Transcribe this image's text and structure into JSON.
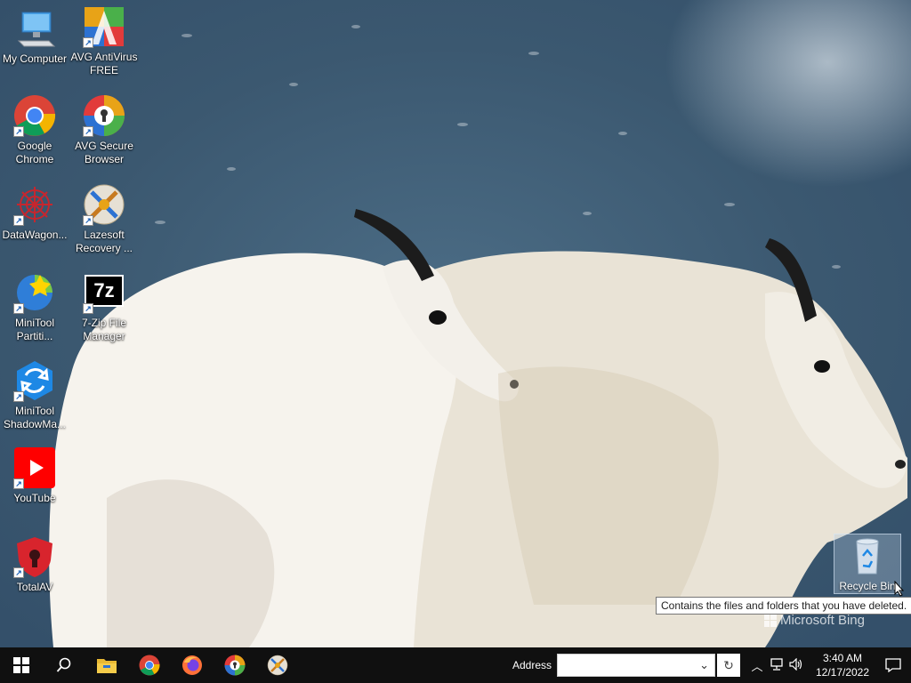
{
  "desktop": {
    "icons": [
      {
        "label": "My Computer",
        "icon": "computer-icon"
      },
      {
        "label": "AVG AntiVirus FREE",
        "icon": "avg-antivirus-icon"
      },
      {
        "label": "Google Chrome",
        "icon": "chrome-icon"
      },
      {
        "label": "AVG Secure Browser",
        "icon": "avg-browser-icon"
      },
      {
        "label": "DataWagon...",
        "icon": "datawagon-icon"
      },
      {
        "label": "Lazesoft Recovery ...",
        "icon": "lazesoft-icon"
      },
      {
        "label": "MiniTool Partiti...",
        "icon": "minitool-partition-icon"
      },
      {
        "label": "7-Zip File Manager",
        "icon": "7zip-icon"
      },
      {
        "label": "MiniTool ShadowMa...",
        "icon": "minitool-shadowmaker-icon"
      },
      {
        "label": "YouTube",
        "icon": "youtube-icon"
      },
      {
        "label": "TotalAV",
        "icon": "totalav-icon"
      }
    ],
    "recycle_bin": {
      "label": "Recycle Bin",
      "icon": "recycle-bin-icon"
    },
    "tooltip": "Contains the files and folders that you have deleted.",
    "watermark": "Microsoft Bing",
    "seven_zip_glyph": "7z"
  },
  "taskbar": {
    "pinned": [
      "start-icon",
      "search-icon",
      "file-explorer-icon",
      "chrome-icon",
      "firefox-icon",
      "avg-browser-icon",
      "lazesoft-icon"
    ],
    "address_label": "Address",
    "address_value": "",
    "time": "3:40 AM",
    "date": "12/17/2022"
  },
  "colors": {
    "taskbar": "#101010",
    "wallpaper_sky": "#3f5d74",
    "goat_fur": "#f2efe8",
    "chrome_red": "#db4437",
    "chrome_green": "#0f9d58",
    "chrome_yellow": "#f4b400",
    "chrome_blue": "#4285f4",
    "youtube_red": "#ff0000",
    "totalav_red": "#d8242d"
  }
}
